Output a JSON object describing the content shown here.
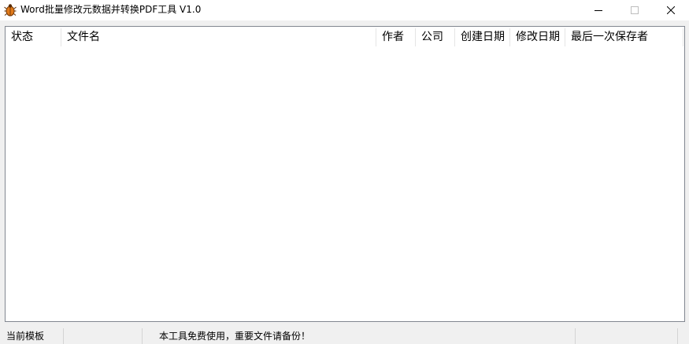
{
  "window": {
    "title": "Word批量修改元数据并转换PDF工具 V1.0",
    "icon": "bug-app-icon",
    "controls": [
      "minimize-icon",
      "maximize-icon",
      "close-icon"
    ]
  },
  "listview": {
    "columns": [
      {
        "label": "状态"
      },
      {
        "label": "文件名"
      },
      {
        "label": "作者"
      },
      {
        "label": "公司"
      },
      {
        "label": "创建日期"
      },
      {
        "label": "修改日期"
      },
      {
        "label": "最后一次保存者"
      }
    ],
    "rows": []
  },
  "statusbar": {
    "panels": [
      {
        "text": "当前模板"
      },
      {
        "text": ""
      },
      {
        "text": "本工具免费使用，重要文件请备份！"
      },
      {
        "text": ""
      }
    ]
  },
  "colors": {
    "title_bar_bg": "#ffffff",
    "window_bg": "#f0f0f0",
    "list_bg": "#ffffff",
    "list_border": "#828790",
    "icon_accent": "#e07a1a"
  }
}
